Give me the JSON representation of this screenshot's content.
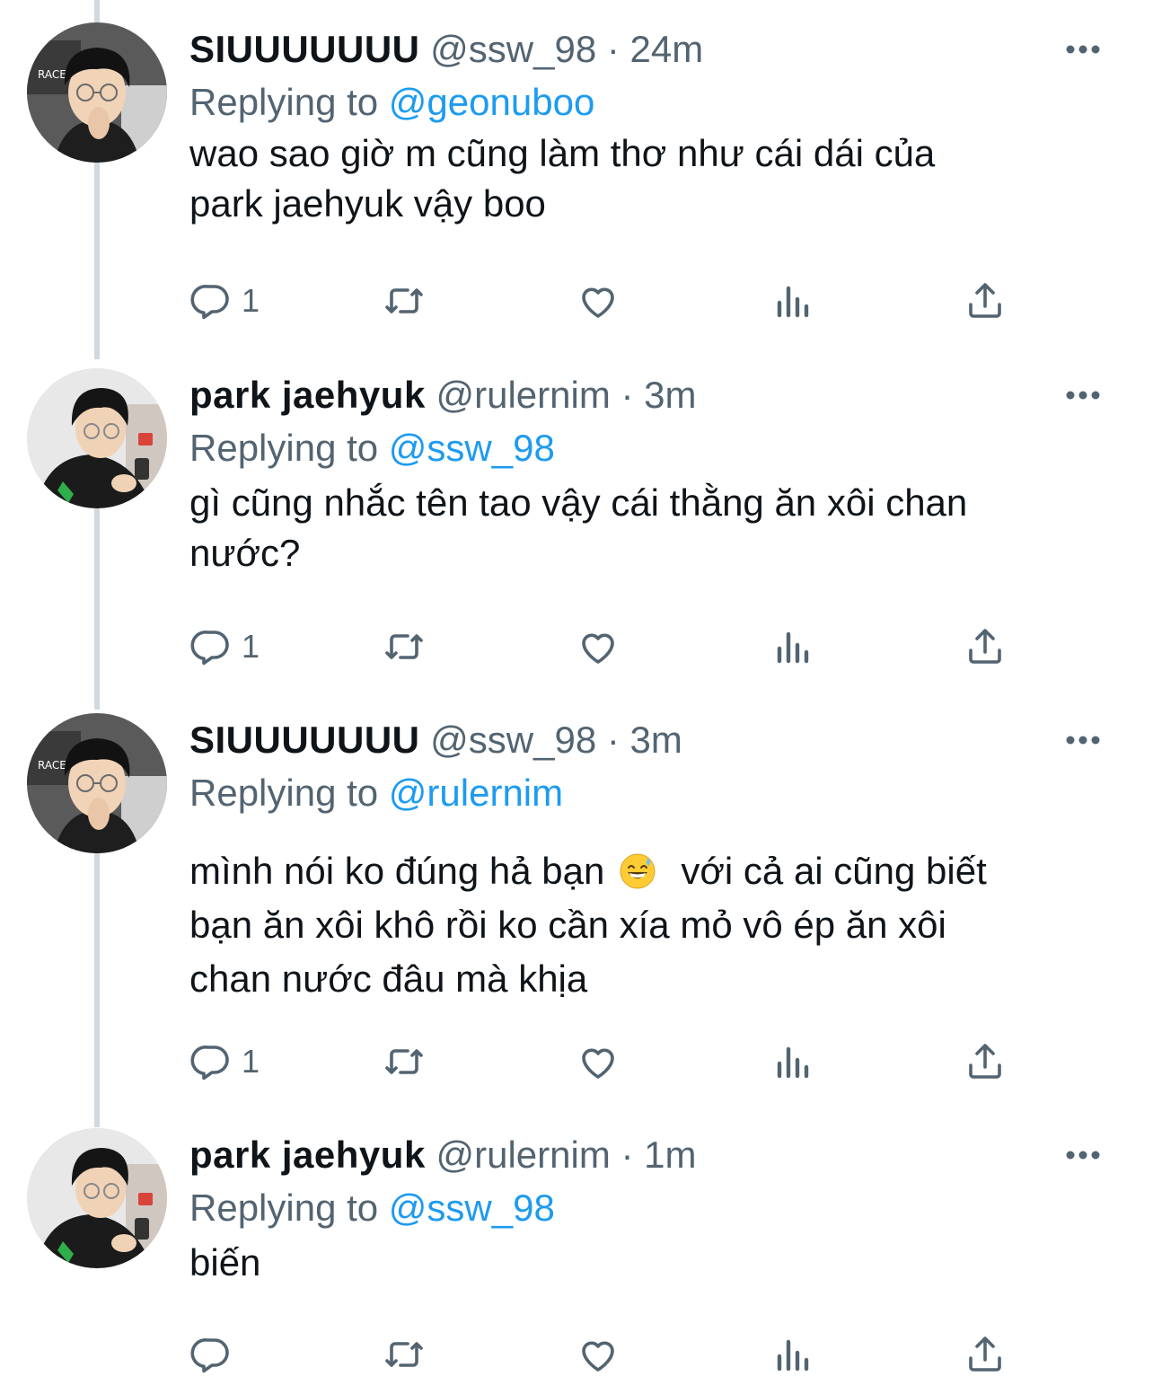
{
  "thread": [
    {
      "name": "SIUUUUUUU",
      "handle": "@ssw_98",
      "separator": " · ",
      "time": "24m",
      "replying_prefix": "Replying to ",
      "replying_to": "@geonuboo",
      "text_lines": [
        "wao sao giờ m cũng làm thơ như cái dái của",
        "park jaehyuk vậy boo"
      ],
      "reply_count": "1",
      "avatar_icon": "person-with-hand-on-chin-avatar"
    },
    {
      "name": "park jaehyuk",
      "handle": "@rulernim",
      "separator": " · ",
      "time": "3m",
      "replying_prefix": "Replying to ",
      "replying_to": "@ssw_98",
      "text_lines": [
        "gì cũng nhắc tên tao vậy cái thằng ăn xôi chan",
        "nước?"
      ],
      "reply_count": "1",
      "avatar_icon": "person-looking-at-phone-avatar"
    },
    {
      "name": "SIUUUUUUU",
      "handle": "@ssw_98",
      "separator": " · ",
      "time": "3m",
      "replying_prefix": "Replying to ",
      "replying_to": "@rulernim",
      "text_line1_before_emoji": "mình nói ko đúng hả bạn ",
      "emoji": "grinning-face-with-sweat-emoji",
      "text_line1_after_emoji": "  với cả ai cũng biết",
      "text_lines": [
        "bạn ăn xôi khô rồi ko cần xía mỏ vô ép ăn xôi",
        "chan nước đâu mà khịa"
      ],
      "reply_count": "1",
      "avatar_icon": "person-with-hand-on-chin-avatar"
    },
    {
      "name": "park jaehyuk",
      "handle": "@rulernim",
      "separator": " · ",
      "time": "1m",
      "replying_prefix": "Replying to ",
      "replying_to": "@ssw_98",
      "text_lines": [
        "biến"
      ],
      "reply_count": "",
      "avatar_icon": "person-looking-at-phone-avatar"
    }
  ],
  "icons": {
    "reply": "reply-icon",
    "retweet": "retweet-icon",
    "like": "like-icon",
    "views": "views-icon",
    "share": "share-icon",
    "more": "more-icon"
  },
  "colors": {
    "text": "#0f1419",
    "secondary": "#536471",
    "mention": "#1d9bf0",
    "thread_line": "#cfd9de"
  }
}
